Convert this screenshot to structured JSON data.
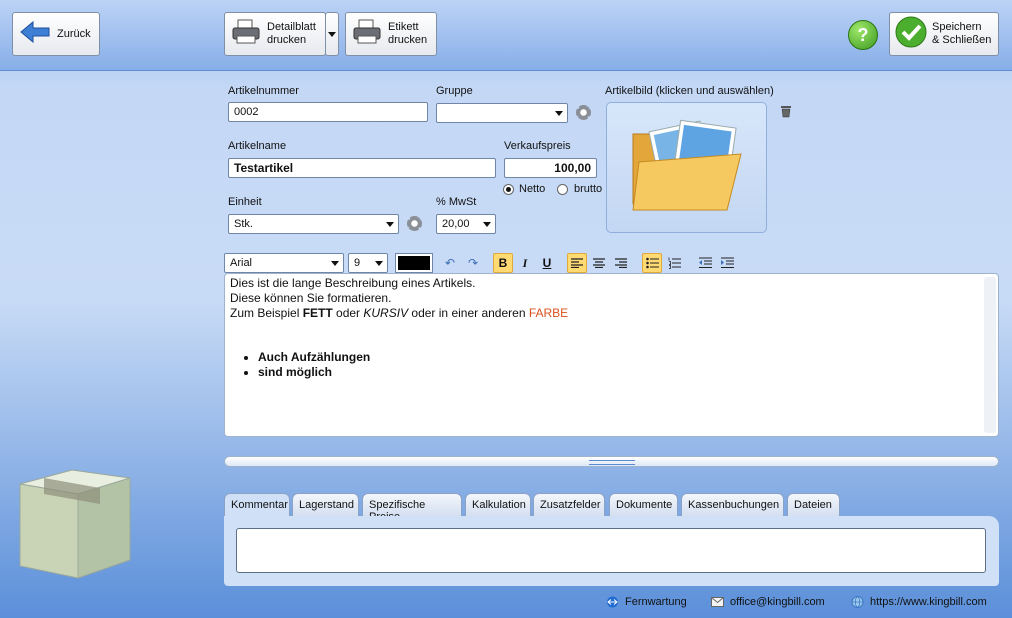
{
  "toolbar": {
    "back_label": "Zurück",
    "detail_print_label": "Detailblatt\ndrucken",
    "label_print_label": "Etikett\ndrucken",
    "save_close_label": "Speichern\n& Schließen",
    "help_icon": "question-icon"
  },
  "form": {
    "article_number_label": "Artikelnummer",
    "article_number_value": "0002",
    "group_label": "Gruppe",
    "group_value": "",
    "image_label": "Artikelbild (klicken und auswählen)",
    "article_name_label": "Artikelname",
    "article_name_value": "Testartikel",
    "price_label": "Verkaufspreis",
    "price_value": "100,00",
    "net_label": "Netto",
    "gross_label": "brutto",
    "price_mode": "Netto",
    "unit_label": "Einheit",
    "unit_value": "Stk.",
    "vat_label": "% MwSt",
    "vat_value": "20,00"
  },
  "editor_toolbar": {
    "font": "Arial",
    "size": "9",
    "color": "#000000"
  },
  "editor": {
    "line1": "Dies ist die lange Beschreibung eines Artikels.",
    "line2": "Diese können Sie formatieren.",
    "line3_a": "Zum Beispiel ",
    "line3_bold": "FETT",
    "line3_b": " oder ",
    "line3_italic": "KURSIV",
    "line3_c": " oder in einer anderen ",
    "line3_color": "FARBE",
    "bullets": [
      "Auch Aufzählungen",
      "sind möglich"
    ],
    "accent_color": "#d9531e"
  },
  "tabs": [
    {
      "label": "Kommentar",
      "active": true
    },
    {
      "label": "Lagerstand"
    },
    {
      "label": "Spezifische Preise"
    },
    {
      "label": "Kalkulation"
    },
    {
      "label": "Zusatzfelder"
    },
    {
      "label": "Dokumente"
    },
    {
      "label": "Kassenbuchungen"
    },
    {
      "label": "Dateien"
    }
  ],
  "footer": {
    "remote": "Fernwartung",
    "email": "office@kingbill.com",
    "web": "https://www.kingbill.com"
  }
}
